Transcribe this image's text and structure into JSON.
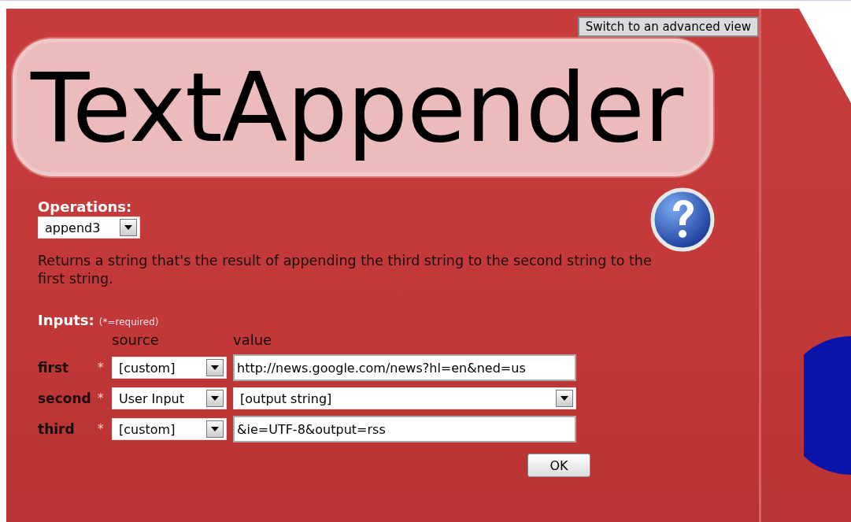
{
  "advanced_view_button": "Switch to an advanced view",
  "title": "TextAppender",
  "operations": {
    "label": "Operations:",
    "selected": "append3",
    "description": "Returns a string that's the result of appending the third string to the second string to the first string."
  },
  "inputs": {
    "label": "Inputs:",
    "note": "(*=required)",
    "columns": [
      "source",
      "value"
    ],
    "rows": [
      {
        "name": "first",
        "required_mark": "*",
        "source": "[custom]",
        "kind": "text",
        "value": "http://news.google.com/news?hl=en&ned=us"
      },
      {
        "name": "second",
        "required_mark": "*",
        "source": "User Input",
        "kind": "select",
        "value": "[output string]"
      },
      {
        "name": "third",
        "required_mark": "*",
        "source": "[custom]",
        "kind": "text",
        "value": "&ie=UTF-8&output=rss"
      }
    ]
  },
  "ok_button": "OK"
}
